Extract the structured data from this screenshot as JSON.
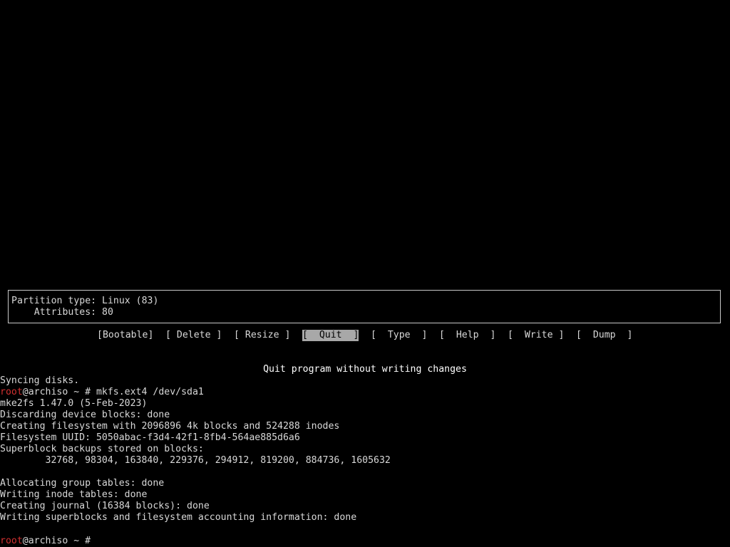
{
  "cfdisk": {
    "info": {
      "partition_type_line": "Partition type: Linux (83)",
      "attributes_line": "    Attributes: 80"
    },
    "menu": [
      {
        "label": "[Bootable]",
        "selected": false
      },
      {
        "label": "[ Delete ]",
        "selected": false
      },
      {
        "label": "[ Resize ]",
        "selected": false
      },
      {
        "label": "[  Quit  ]",
        "selected": true
      },
      {
        "label": "[  Type  ]",
        "selected": false
      },
      {
        "label": "[  Help  ]",
        "selected": false
      },
      {
        "label": "[  Write ]",
        "selected": false
      },
      {
        "label": "[  Dump  ]",
        "selected": false
      }
    ],
    "hint": "Quit program without writing changes"
  },
  "terminal": {
    "prompt_user": "root",
    "prompt_rest": "@archiso ~ # ",
    "lines": [
      "Syncing disks.",
      "mkfs.ext4 /dev/sda1",
      "mke2fs 1.47.0 (5-Feb-2023)",
      "Discarding device blocks: done",
      "Creating filesystem with 2096896 4k blocks and 524288 inodes",
      "Filesystem UUID: 5050abac-f3d4-42f1-8fb4-564ae885d6a6",
      "Superblock backups stored on blocks:",
      "        32768, 98304, 163840, 229376, 294912, 819200, 884736, 1605632",
      "",
      "Allocating group tables: done",
      "Writing inode tables: done",
      "Creating journal (16384 blocks): done",
      "Writing superblocks and filesystem accounting information: done",
      "",
      ""
    ]
  },
  "colors": {
    "background": "#000000",
    "text": "#d8d8d8",
    "prompt_user": "#d03030",
    "selected_bg": "#a8a8a8"
  }
}
